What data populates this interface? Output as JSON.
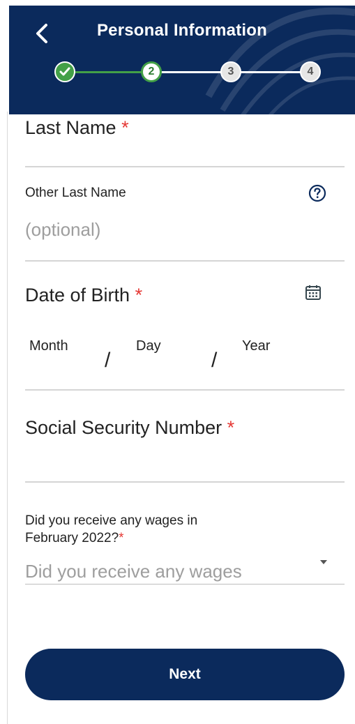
{
  "header": {
    "title": "Personal Information",
    "back_icon": "chevron-left-icon",
    "background": "#0b2a5c"
  },
  "stepper": {
    "steps": [
      {
        "label": "",
        "state": "complete",
        "icon": "check-icon"
      },
      {
        "label": "2",
        "state": "current"
      },
      {
        "label": "3",
        "state": "upcoming"
      },
      {
        "label": "4",
        "state": "upcoming"
      }
    ],
    "complete_color": "#43a047"
  },
  "form": {
    "last_name": {
      "label": "Last Name",
      "required_mark": "*"
    },
    "other_last_name": {
      "label": "Other Last Name",
      "placeholder": "(optional)",
      "help_icon": "help-circle-icon"
    },
    "date_of_birth": {
      "label": "Date of Birth",
      "required_mark": "*",
      "month": "Month",
      "day": "Day",
      "year": "Year",
      "separator": "/",
      "calendar_icon": "calendar-icon"
    },
    "ssn": {
      "label": "Social Security Number",
      "required_mark": "*"
    },
    "wages": {
      "label_line1": "Did you receive any wages in",
      "label_line2": "February 2022?",
      "required_mark": "*",
      "placeholder": "Did you receive any wages",
      "dropdown_icon": "caret-down-icon"
    }
  },
  "actions": {
    "next_label": "Next"
  },
  "colors": {
    "primary": "#0b2a5c",
    "required": "#e53935",
    "placeholder": "#9e9e9e"
  }
}
